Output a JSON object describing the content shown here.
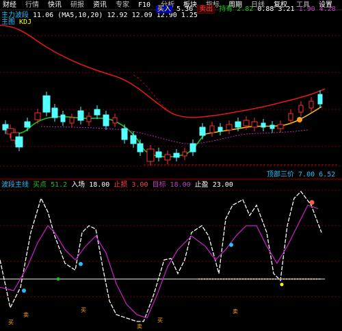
{
  "colors": {
    "background": "#000000",
    "up_candle": "#ff3030",
    "down_candle": "#54ffff",
    "ma_red": "#e01818",
    "ma_green": "#20c020",
    "ma_yellow": "#f0c020",
    "ma_purple": "#c020c0",
    "osc_white": "#ffffff",
    "osc_magenta": "#c020c0",
    "grid_red": "#800000",
    "zero_line": "#c0c0c0"
  },
  "top_bar": {
    "segments": [
      "财经",
      "行情",
      "快讯",
      "研报",
      "资讯",
      "专家",
      "F10",
      "分析",
      "板块",
      "指标",
      "周期",
      "日线",
      "复权",
      "工具",
      "设置"
    ]
  },
  "price_panel": {
    "header": {
      "title_a": "主力波段",
      "value_a": "11.06",
      "title_b": "(MA5,10,20)",
      "value_b": "12.92",
      "value_c": "12.09",
      "value_d": "12.90",
      "value_e": "1.25",
      "hl_label": "买入",
      "hl_value": "5.36",
      "tag_red": "卖出",
      "tag_green": "持有",
      "val_green": "2.82",
      "val_b1": "0.88",
      "val_b2": "3.21",
      "val_p1": "1.90",
      "val_p2": "4.28"
    },
    "subheader": {
      "label": "主图",
      "value": "KDJ"
    }
  },
  "osc_panel": {
    "header": {
      "title": "波段主线",
      "label_1": "买点",
      "value_1": "51.2",
      "label_2": "入场",
      "value_2": "18.00",
      "label_3": "止损",
      "value_3": "3.00",
      "label_4": "目标",
      "value_4": "18.00",
      "label_5": "止盈",
      "value_5": "23.00"
    },
    "side_label": "顶部三价",
    "side_value_1": "7.00",
    "side_value_2": "6.52",
    "markers": [
      "买",
      "卖",
      "买",
      "卖",
      "买",
      "卖"
    ]
  }
}
